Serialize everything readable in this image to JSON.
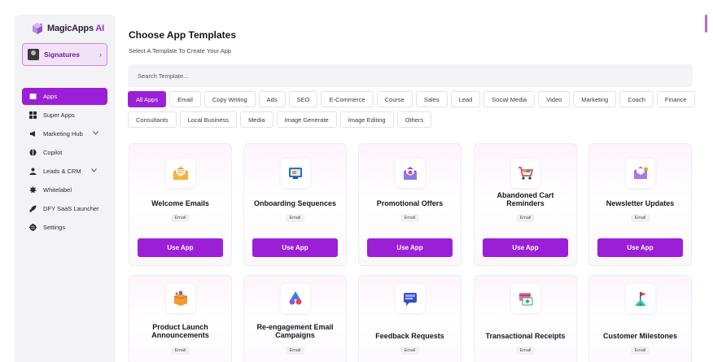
{
  "brand": {
    "name": "MagicApps",
    "suffix": "AI"
  },
  "signatures": {
    "label": "Signatures",
    "chevron": "›"
  },
  "nav": [
    {
      "label": "Apps",
      "icon": "apps-icon",
      "active": true
    },
    {
      "label": "Super Apps",
      "icon": "super-apps-icon"
    },
    {
      "label": "Marketing Hub",
      "icon": "megaphone-icon",
      "chevron": true
    },
    {
      "label": "Copilot",
      "icon": "copilot-icon"
    },
    {
      "label": "Leads & CRM",
      "icon": "users-icon",
      "chevron": true
    },
    {
      "label": "Whitelabel",
      "icon": "whitelabel-icon"
    },
    {
      "label": "DFY SaaS Launcher",
      "icon": "rocket-icon"
    },
    {
      "label": "Settings",
      "icon": "gear-icon"
    }
  ],
  "main": {
    "title": "Choose App Templates",
    "subtitle": "Select A Template To Create Your App",
    "search_placeholder": "Search Template..."
  },
  "categories": [
    "All Apps",
    "Email",
    "Copy Writing",
    "Ads",
    "SEO",
    "E-Commerce",
    "Course",
    "Sales",
    "Lead",
    "Social Media",
    "Video",
    "Marketing",
    "Coach",
    "Finance",
    "Consultants",
    "Local Business",
    "Media",
    "Image Generate",
    "Image Editing",
    "Others"
  ],
  "active_category": "All Apps",
  "cards": [
    {
      "title": "Welcome Emails",
      "tag": "Email",
      "button": "Use App",
      "icon": "envelope-open-icon"
    },
    {
      "title": "Onboarding Sequences",
      "tag": "Email",
      "button": "Use App",
      "icon": "onboarding-screen-icon"
    },
    {
      "title": "Promotional Offers",
      "tag": "Email",
      "button": "Use App",
      "icon": "promo-mail-icon"
    },
    {
      "title": "Abandoned Cart Reminders",
      "tag": "Email",
      "button": "Use App",
      "icon": "shopping-cart-icon"
    },
    {
      "title": "Newsletter Updates",
      "tag": "Email",
      "button": "Use App",
      "icon": "newsletter-icon"
    },
    {
      "title": "Product Launch Announcements",
      "tag": "Email",
      "icon": "product-box-icon"
    },
    {
      "title": "Re-engagement Email Campaigns",
      "tag": "Email",
      "icon": "engagement-icon"
    },
    {
      "title": "Feedback Requests",
      "tag": "Email",
      "icon": "feedback-icon"
    },
    {
      "title": "Transactional Receipts",
      "tag": "Email",
      "icon": "receipt-icon"
    },
    {
      "title": "Customer Milestones",
      "tag": "Email",
      "icon": "milestone-flag-icon"
    }
  ],
  "colors": {
    "accent": "#9a1fd6",
    "sidebar_bg": "#f3f2f5",
    "signature_bg": "#f1e2f8"
  }
}
